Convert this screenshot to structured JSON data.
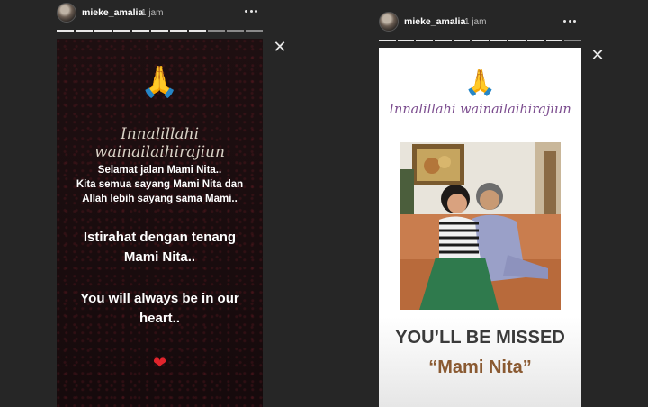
{
  "stories": [
    {
      "username": "mieke_amalia",
      "time": "1 jam",
      "script_text": "Innalillahi wainailaihirajiun",
      "message_lines": [
        "Selamat jalan Mami Nita..",
        "Kita semua sayang Mami Nita dan",
        "Allah lebih sayang sama Mami.."
      ],
      "rest_lines": [
        "Istirahat dengan tenang",
        "Mami Nita.."
      ],
      "heart_lines": [
        "You will always be in our",
        "heart.."
      ]
    },
    {
      "username": "mieke_amalia",
      "time": "1 jam",
      "script_text": "Innalillahi wainailaihirajiun",
      "missed_text": "YOU’LL BE MISSED",
      "name_text": "“Mami Nita”"
    }
  ],
  "icons": {
    "more": "more-horizontal-icon",
    "close": "close-icon",
    "prayer": "folded-hands-emoji",
    "heart": "red-heart-emoji"
  },
  "colors": {
    "background": "#262626",
    "left_story_bg": "#1d0f10",
    "script_left": "#d9d2c6",
    "script_right": "#7c4d8f",
    "name_brown": "#8a5a32",
    "missed_dark": "#3a3a3a"
  },
  "progress": {
    "left": {
      "segments": 11,
      "completed": 8
    },
    "right": {
      "segments": 11,
      "completed": 10
    }
  }
}
